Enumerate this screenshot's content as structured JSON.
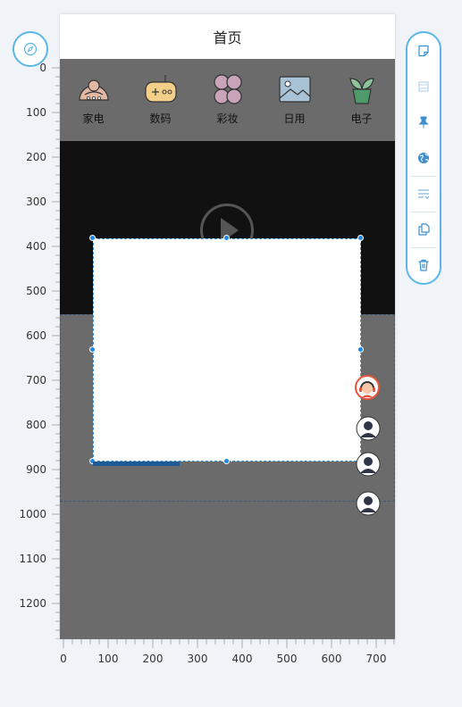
{
  "page": {
    "title": "首页"
  },
  "categories": [
    {
      "label": "家电",
      "icon": "appliance-icon"
    },
    {
      "label": "数码",
      "icon": "gamepad-icon"
    },
    {
      "label": "彩妆",
      "icon": "flower-icon"
    },
    {
      "label": "日用",
      "icon": "picture-icon"
    },
    {
      "label": "电子",
      "icon": "plant-icon"
    }
  ],
  "ruler": {
    "vertical": [
      "0",
      "100",
      "200",
      "300",
      "400",
      "500",
      "600",
      "700",
      "800",
      "900",
      "1000",
      "1100",
      "1200"
    ],
    "horizontal": [
      "0",
      "100",
      "200",
      "300",
      "400",
      "500",
      "600",
      "700"
    ]
  },
  "toolbar": [
    "note-icon",
    "layer-icon",
    "pin-icon",
    "globe-icon",
    "wrap-icon",
    "copy-icon",
    "trash-icon"
  ],
  "colors": {
    "accent": "#5bb6e8",
    "handle": "#1e88e5",
    "canvas": "#6b6b6b",
    "video": "#111111"
  }
}
